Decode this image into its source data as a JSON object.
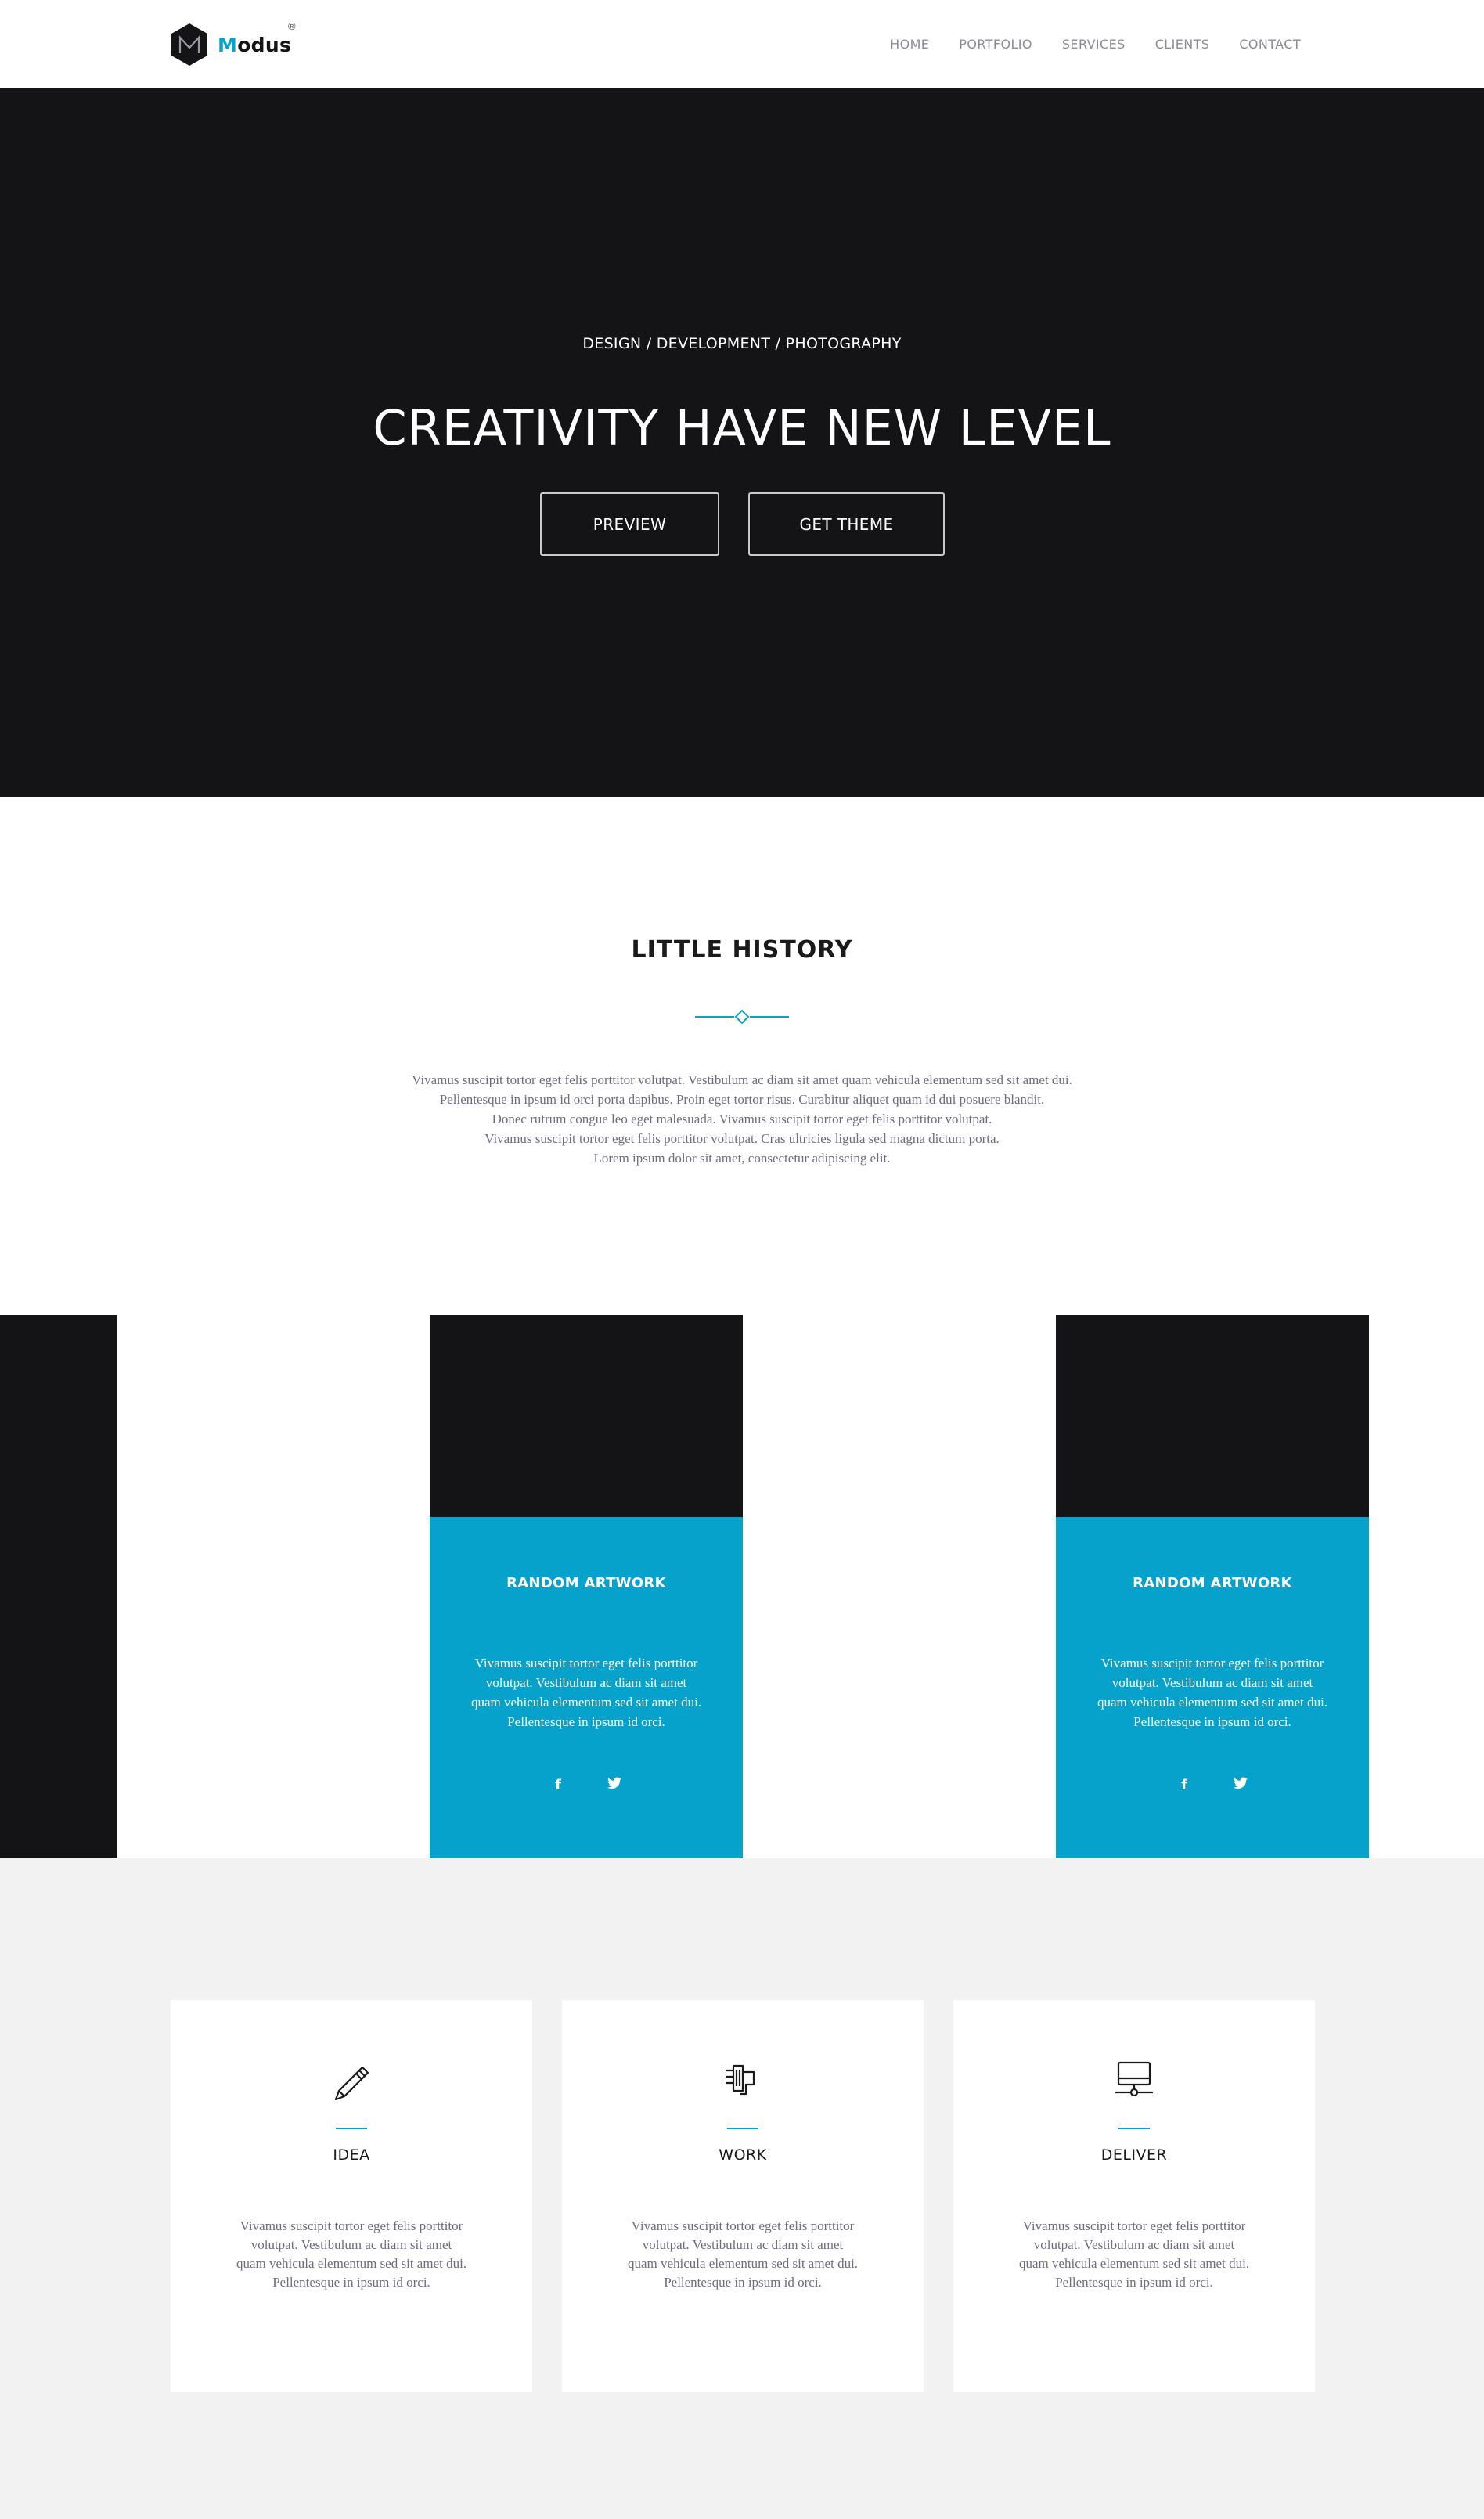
{
  "brand": {
    "name_first": "M",
    "name_rest": "odus",
    "registered": "®",
    "accent": "#06a2cc",
    "dark": "#141416"
  },
  "nav": {
    "items": [
      {
        "label": "HOME"
      },
      {
        "label": "PORTFOLIO"
      },
      {
        "label": "SERVICES"
      },
      {
        "label": "CLIENTS"
      },
      {
        "label": "CONTACT"
      }
    ]
  },
  "hero": {
    "subtitle": "DESIGN / DEVELOPMENT / PHOTOGRAPHY",
    "title": "CREATIVITY HAVE NEW LEVEL",
    "preview_label": "PREVIEW",
    "get_theme_label": "GET THEME"
  },
  "history": {
    "title": "LITTLE HISTORY",
    "lines": [
      "Vivamus suscipit tortor eget felis porttitor volutpat. Vestibulum ac diam sit amet quam vehicula elementum sed sit amet dui.",
      "Pellentesque in ipsum id orci porta dapibus. Proin eget tortor risus. Curabitur aliquet quam id dui posuere blandit.",
      "Donec rutrum congue leo eget malesuada. Vivamus suscipit tortor eget felis porttitor volutpat.",
      "Vivamus suscipit tortor eget felis porttitor volutpat. Cras ultricies ligula sed magna dictum porta.",
      "Lorem ipsum dolor sit amet, consectetur adipiscing elit."
    ]
  },
  "portfolio": {
    "cards": [
      {
        "title": "RANDOM ARTWORK",
        "lines": [
          "Vivamus suscipit tortor eget felis porttitor",
          "volutpat. Vestibulum ac diam sit amet",
          "quam vehicula elementum sed sit amet dui.",
          "Pellentesque in ipsum id orci."
        ],
        "social": [
          {
            "icon": "facebook-icon",
            "glyph": "f"
          },
          {
            "icon": "twitter-icon",
            "glyph": "🐦"
          }
        ]
      },
      {
        "title": "RANDOM ARTWORK",
        "lines": [
          "Vivamus suscipit tortor eget felis porttitor",
          "volutpat. Vestibulum ac diam sit amet",
          "quam vehicula elementum sed sit amet dui.",
          "Pellentesque in ipsum id orci."
        ],
        "social": [
          {
            "icon": "facebook-icon",
            "glyph": "f"
          },
          {
            "icon": "twitter-icon",
            "glyph": "🐦"
          }
        ]
      }
    ]
  },
  "services": [
    {
      "icon": "pencil-icon",
      "title": "IDEA",
      "lines": [
        "Vivamus suscipit tortor eget felis porttitor",
        "volutpat. Vestibulum ac diam sit amet",
        "quam vehicula elementum sed sit amet dui.",
        "Pellentesque in ipsum id orci."
      ]
    },
    {
      "icon": "plug-icon",
      "title": "WORK",
      "lines": [
        "Vivamus suscipit tortor eget felis porttitor",
        "volutpat. Vestibulum ac diam sit amet",
        "quam vehicula elementum sed sit amet dui.",
        "Pellentesque in ipsum id orci."
      ]
    },
    {
      "icon": "monitor-network-icon",
      "title": "DELIVER",
      "lines": [
        "Vivamus suscipit tortor eget felis porttitor",
        "volutpat. Vestibulum ac diam sit amet",
        "quam vehicula elementum sed sit amet dui.",
        "Pellentesque in ipsum id orci."
      ]
    }
  ]
}
